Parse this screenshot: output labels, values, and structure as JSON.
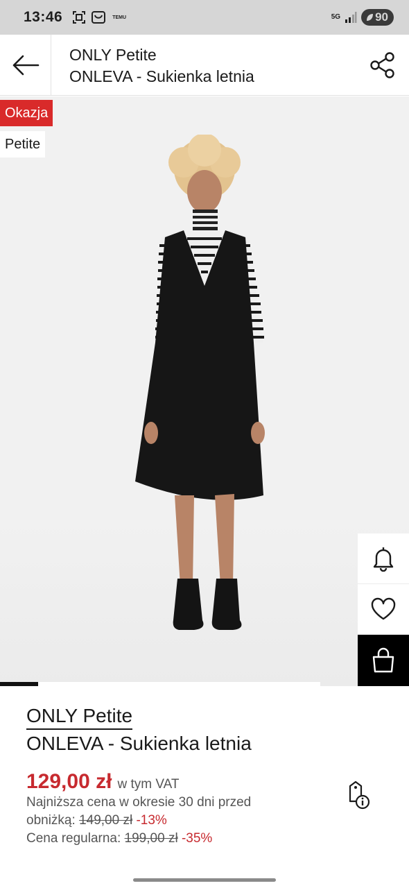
{
  "status_bar": {
    "time": "13:46",
    "temu_label": "TEMU",
    "network": "5G",
    "battery": "90"
  },
  "header": {
    "brand": "ONLY Petite",
    "product": "ONLEVA - Sukienka letnia",
    "back_icon": "arrow-left-icon",
    "share_icon": "share-icon"
  },
  "badges": {
    "deal": "Okazja",
    "size_line": "Petite"
  },
  "gallery": {
    "image_position": 1,
    "progress_fraction": 0.12
  },
  "side_actions": {
    "notify_icon": "bell-icon",
    "wishlist_icon": "heart-icon",
    "bag_icon": "shopping-bag-icon"
  },
  "product": {
    "brand": "ONLY Petite",
    "name": "ONLEVA - Sukienka letnia",
    "price": "129,00 zł",
    "vat_note": "w tym VAT",
    "lowest_price_label_1": "Najniższa cena w okresie 30 dni przed",
    "lowest_price_label_2": "obniżką:",
    "lowest_price": "149,00 zł",
    "lowest_price_discount": "-13%",
    "regular_price_label": "Cena regularna:",
    "regular_price": "199,00 zł",
    "regular_price_discount": "-35%"
  },
  "colors": {
    "accent_red": "#c72a2f",
    "badge_red": "#d92a2a",
    "bag_button_bg": "#000000"
  }
}
